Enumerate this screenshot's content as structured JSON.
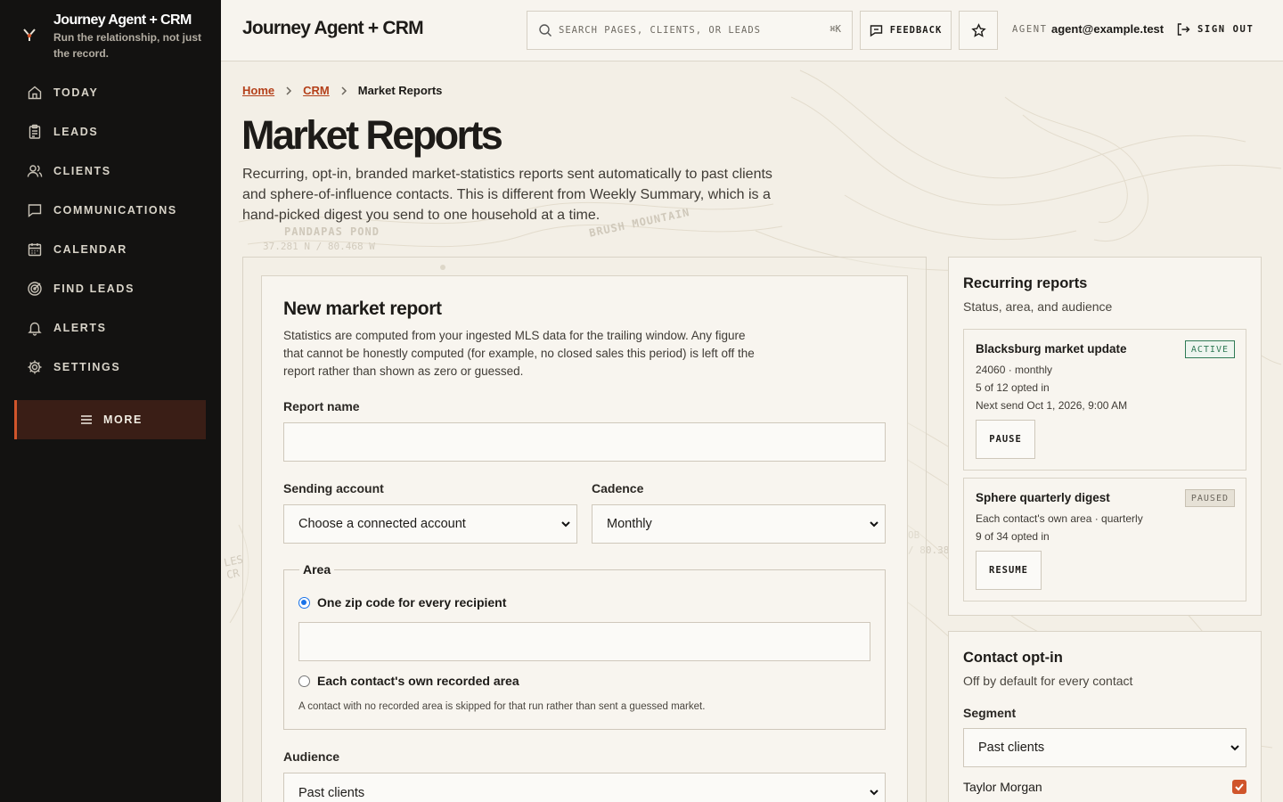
{
  "brand": {
    "title": "Journey Agent + CRM",
    "tagline": "Run the relationship, not just the record."
  },
  "nav": [
    {
      "label": "TODAY",
      "icon": "home-icon"
    },
    {
      "label": "LEADS",
      "icon": "clipboard-icon"
    },
    {
      "label": "CLIENTS",
      "icon": "users-icon"
    },
    {
      "label": "COMMUNICATIONS",
      "icon": "message-icon"
    },
    {
      "label": "CALENDAR",
      "icon": "calendar-icon"
    },
    {
      "label": "FIND LEADS",
      "icon": "target-icon"
    },
    {
      "label": "ALERTS",
      "icon": "bell-icon"
    },
    {
      "label": "SETTINGS",
      "icon": "gear-icon"
    }
  ],
  "more_label": "MORE",
  "header": {
    "title": "Journey Agent + CRM",
    "search_placeholder": "SEARCH PAGES, CLIENTS, OR LEADS",
    "search_shortcut": "⌘K",
    "feedback_label": "FEEDBACK",
    "agent_label": "AGENT",
    "agent_email": "agent@example.test",
    "signout_label": "SIGN OUT"
  },
  "breadcrumb": {
    "home": "Home",
    "crm": "CRM",
    "current": "Market Reports"
  },
  "page": {
    "title": "Market Reports",
    "description": "Recurring, opt-in, branded market-statistics reports sent automatically to past clients and sphere-of-influence contacts. This is different from Weekly Summary, which is a hand-picked digest you send to one household at a time."
  },
  "map_labels": {
    "pond": "PANDAPAS POND",
    "coords": "37.281 N / 80.468 W",
    "mountain": "BRUSH MOUNTAIN",
    "left_edge": "LES CR",
    "right_edge_1": "OB",
    "right_edge_2": "/ 80.38"
  },
  "form": {
    "title": "New market report",
    "description": "Statistics are computed from your ingested MLS data for the trailing window. Any figure that cannot be honestly computed (for example, no closed sales this period) is left off the report rather than shown as zero or guessed.",
    "report_name_label": "Report name",
    "report_name_value": "",
    "sending_account_label": "Sending account",
    "sending_account_value": "Choose a connected account",
    "cadence_label": "Cadence",
    "cadence_value": "Monthly",
    "area_legend": "Area",
    "area_option_zip": "One zip code for every recipient",
    "zip_value": "",
    "area_option_own": "Each contact's own recorded area",
    "area_note": "A contact with no recorded area is skipped for that run rather than sent a guessed market.",
    "audience_label": "Audience",
    "audience_value": "Past clients"
  },
  "recurring": {
    "title": "Recurring reports",
    "subtitle": "Status, area, and audience",
    "reports": [
      {
        "name": "Blacksburg market update",
        "status": "ACTIVE",
        "area": "24060 · monthly",
        "optin": "5 of 12 opted in",
        "next": "Next send Oct 1, 2026, 9:00 AM",
        "action": "PAUSE"
      },
      {
        "name": "Sphere quarterly digest",
        "status": "PAUSED",
        "area": "Each contact's own area · quarterly",
        "optin": "9 of 34 opted in",
        "action": "RESUME"
      }
    ]
  },
  "optin": {
    "title": "Contact opt-in",
    "subtitle": "Off by default for every contact",
    "segment_label": "Segment",
    "segment_value": "Past clients",
    "contacts": [
      {
        "name": "Taylor Morgan",
        "checked": true
      }
    ]
  },
  "colors": {
    "accent": "#d0552b",
    "link": "#b4401a",
    "sidebar": "#131211",
    "active_green": "#2f7a55"
  }
}
